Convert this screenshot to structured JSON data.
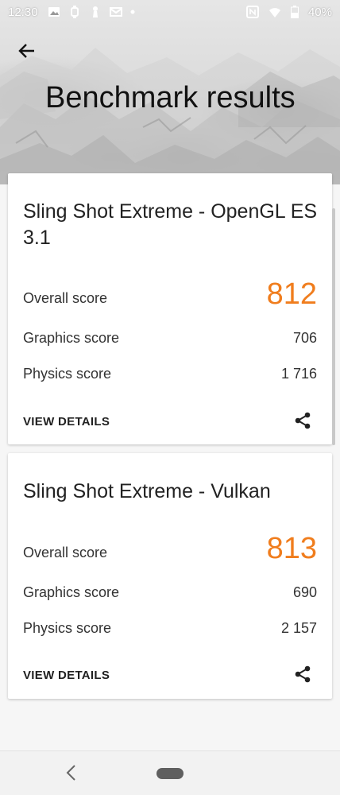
{
  "status_bar": {
    "time": "12:30",
    "battery": "40%",
    "icons_left": [
      "image-icon",
      "wearable-icon",
      "pawn-icon",
      "mail-icon",
      "dot-icon"
    ],
    "icons_right": [
      "nfc-icon",
      "wifi-icon",
      "battery-icon"
    ]
  },
  "header": {
    "title": "Benchmark results"
  },
  "cards": [
    {
      "title": "Sling Shot Extreme - OpenGL ES 3.1",
      "overall_label": "Overall score",
      "overall_value": "812",
      "graphics_label": "Graphics score",
      "graphics_value": "706",
      "physics_label": "Physics score",
      "physics_value": "1 716",
      "details_label": "VIEW DETAILS"
    },
    {
      "title": "Sling Shot Extreme - Vulkan",
      "overall_label": "Overall score",
      "overall_value": "813",
      "graphics_label": "Graphics score",
      "graphics_value": "690",
      "physics_label": "Physics score",
      "physics_value": "2 157",
      "details_label": "VIEW DETAILS"
    }
  ],
  "colors": {
    "accent": "#f07d1d",
    "card_bg": "#ffffff",
    "page_bg": "#f6f6f6"
  }
}
